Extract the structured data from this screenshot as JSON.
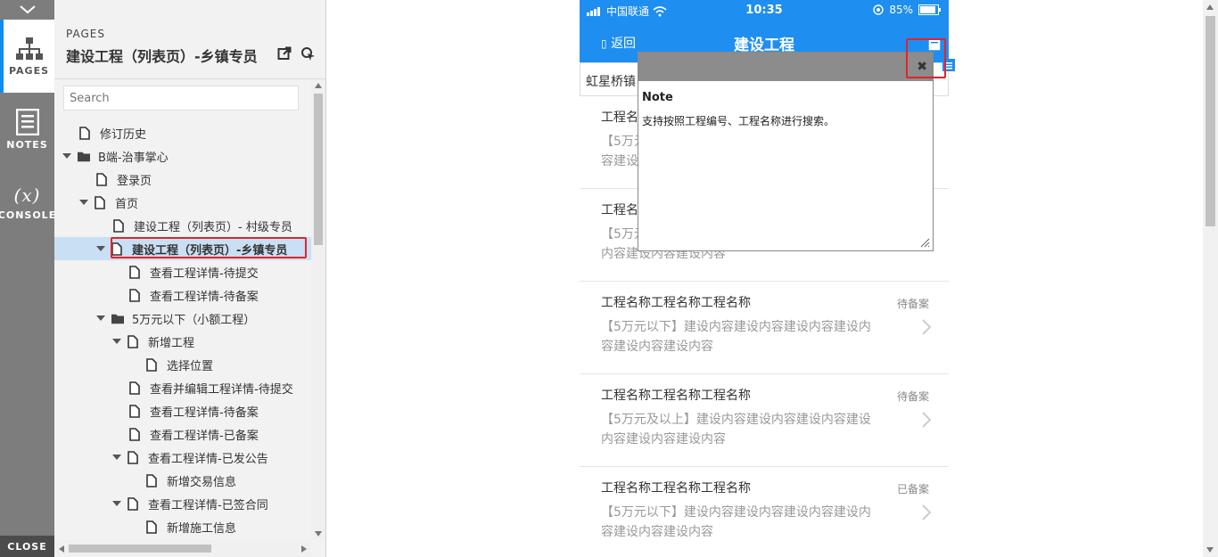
{
  "rail": {
    "pages_label": "PAGES",
    "notes_label": "NOTES",
    "console_label": "CONSOLE",
    "console_glyph": "(x)",
    "close_label": "CLOSE",
    "accent": "#0d8df2"
  },
  "panel": {
    "section_label": "PAGES",
    "title": "建设工程（列表页）-乡镇专员",
    "search_placeholder": "Search",
    "tree": [
      {
        "label": "修订历史",
        "type": "page"
      },
      {
        "label": "B端-治事掌心",
        "type": "folder",
        "expanded": true
      },
      {
        "label": "登录页",
        "type": "page"
      },
      {
        "label": "首页",
        "type": "page",
        "expanded": true
      },
      {
        "label": "建设工程（列表页）- 村级专员",
        "type": "page"
      },
      {
        "label": "建设工程（列表页）-乡镇专员",
        "type": "page",
        "expanded": true,
        "selected": true
      },
      {
        "label": "查看工程详情-待提交",
        "type": "page"
      },
      {
        "label": "查看工程详情-待备案",
        "type": "page"
      },
      {
        "label": "5万元以下（小额工程）",
        "type": "folder",
        "expanded": true
      },
      {
        "label": "新增工程",
        "type": "page",
        "expanded": true
      },
      {
        "label": "选择位置",
        "type": "page"
      },
      {
        "label": "查看并编辑工程详情-待提交",
        "type": "page"
      },
      {
        "label": "查看工程详情-待备案",
        "type": "page"
      },
      {
        "label": "查看工程详情-已备案",
        "type": "page"
      },
      {
        "label": "查看工程详情-已发公告",
        "type": "page",
        "expanded": true
      },
      {
        "label": "新增交易信息",
        "type": "page"
      },
      {
        "label": "查看工程详情-已签合同",
        "type": "page",
        "expanded": true
      },
      {
        "label": "新增施工信息",
        "type": "page"
      }
    ]
  },
  "phone": {
    "carrier": "中国联通",
    "time": "10:35",
    "battery": "85%",
    "back_label": "返回",
    "title": "建设工程",
    "location": "虹星桥镇",
    "items": [
      {
        "name": "工程名",
        "status": "",
        "desc": "【5万元",
        "desc2": "容建设内"
      },
      {
        "name": "工程名",
        "status": "",
        "desc": "【5万元",
        "desc2": "内容建设内容建设内容"
      },
      {
        "name": "工程名称工程名称工程名称",
        "status": "待备案",
        "desc": "【5万元以下】建设内容建设内容建设内容建设内",
        "desc2": "容建设内容建设内容"
      },
      {
        "name": "工程名称工程名称工程名称",
        "status": "待备案",
        "desc": "【5万元及以上】建设内容建设内容建设内容建设",
        "desc2": "内容建设内容建设内容"
      },
      {
        "name": "工程名称工程名称工程名称",
        "status": "已备案",
        "desc": "【5万元以下】建设内容建设内容建设内容建设内",
        "desc2": "容建设内容建设内容"
      }
    ],
    "brand_color": "#1e8ef0"
  },
  "note": {
    "heading": "Note",
    "body": "支持按照工程编号、工程名称进行搜索。",
    "close_glyph": "✖"
  }
}
